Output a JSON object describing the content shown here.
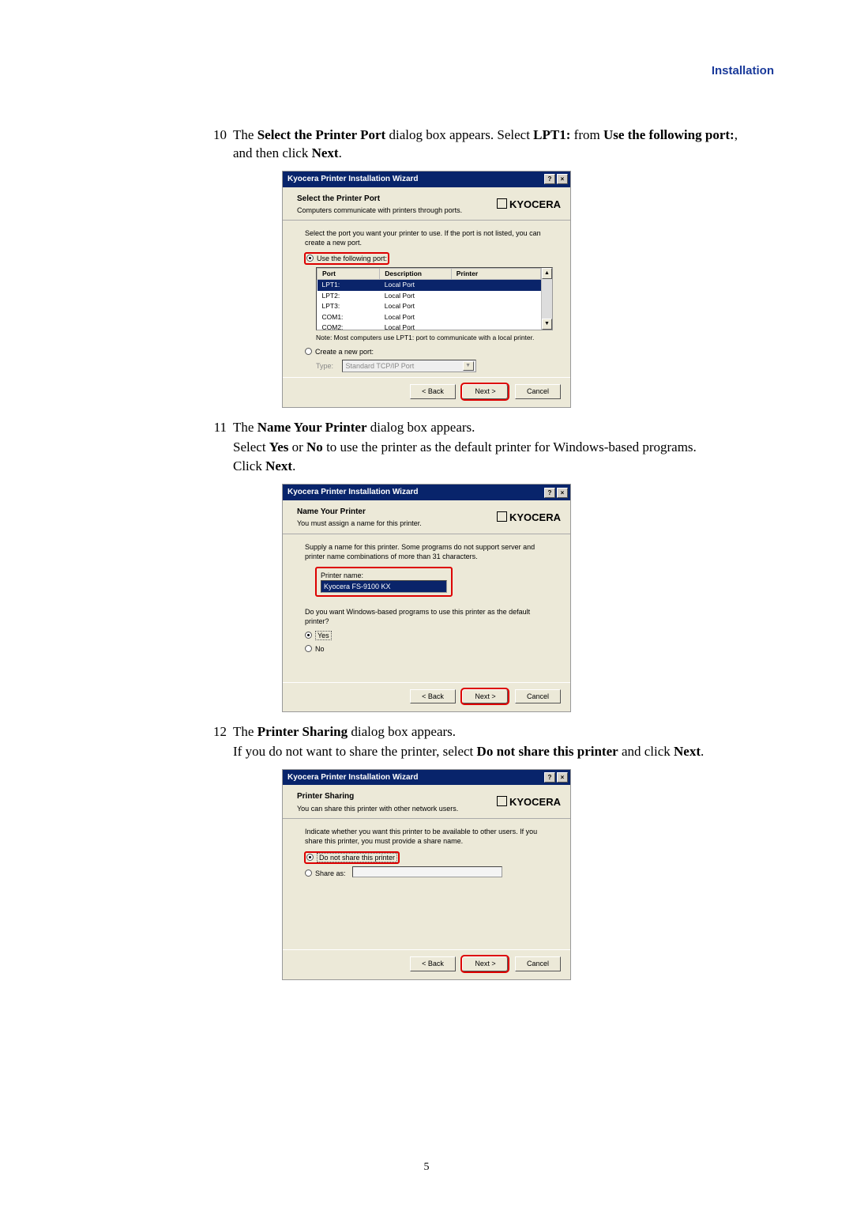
{
  "header_right": "Installation",
  "page_number": "5",
  "steps": {
    "s10": {
      "num": "10",
      "text_pre": "The ",
      "b1": "Select the Printer Port",
      "text_mid1": " dialog box appears. Select ",
      "b2": "LPT1:",
      "text_mid2": " from ",
      "b3": "Use the following port:",
      "text_mid3": ", and then click ",
      "b4": "Next",
      "text_end": "."
    },
    "s11": {
      "num": "11",
      "line1_pre": "The ",
      "line1_b": "Name Your Printer",
      "line1_post": " dialog box appears.",
      "line2_pre": "Select ",
      "line2_b1": "Yes",
      "line2_mid": " or ",
      "line2_b2": "No",
      "line2_post": " to use the printer as the default printer for Windows-based programs.",
      "line3_pre": "Click ",
      "line3_b": "Next",
      "line3_post": "."
    },
    "s12": {
      "num": "12",
      "line1_pre": "The ",
      "line1_b": "Printer Sharing",
      "line1_post": " dialog box appears.",
      "line2_pre": "If you do not want to share the printer, select ",
      "line2_b1": "Do not share this printer",
      "line2_mid": " and click ",
      "line2_b2": "Next",
      "line2_post": "."
    }
  },
  "dlg1": {
    "titlebar": "Kyocera Printer Installation Wizard",
    "help": "?",
    "close": "×",
    "brand": "KYOCERA",
    "htitle": "Select the Printer Port",
    "hsub": "Computers communicate with printers through ports.",
    "intro": "Select the port you want your printer to use. If the port is not listed, you can create a new port.",
    "radio1": "Use the following port:",
    "cols": {
      "c1": "Port",
      "c2": "Description",
      "c3": "Printer"
    },
    "rows": [
      {
        "c1": "LPT1:",
        "c2": "Local Port",
        "c3": ""
      },
      {
        "c1": "LPT2:",
        "c2": "Local Port",
        "c3": ""
      },
      {
        "c1": "LPT3:",
        "c2": "Local Port",
        "c3": ""
      },
      {
        "c1": "COM1:",
        "c2": "Local Port",
        "c3": ""
      },
      {
        "c1": "COM2:",
        "c2": "Local Port",
        "c3": ""
      }
    ],
    "note": "Note: Most computers use LPT1: port to communicate with a local printer.",
    "radio2": "Create a new port:",
    "typelabel": "Type:",
    "typedrop": "Standard TCP/IP Port",
    "back": "< Back",
    "next": "Next >",
    "cancel": "Cancel"
  },
  "dlg2": {
    "titlebar": "Kyocera Printer Installation Wizard",
    "help": "?",
    "close": "×",
    "brand": "KYOCERA",
    "htitle": "Name Your Printer",
    "hsub": "You must assign a name for this printer.",
    "intro": "Supply a name for this printer. Some programs do not support server and printer name combinations of more than 31 characters.",
    "pname_label": "Printer name:",
    "pname_value": "Kyocera FS-9100 KX",
    "defq": "Do you want Windows-based programs to use this printer as the default printer?",
    "yes": "Yes",
    "no": "No",
    "back": "< Back",
    "next": "Next >",
    "cancel": "Cancel"
  },
  "dlg3": {
    "titlebar": "Kyocera Printer Installation Wizard",
    "help": "?",
    "close": "×",
    "brand": "KYOCERA",
    "htitle": "Printer Sharing",
    "hsub": "You can share this printer with other network users.",
    "intro": "Indicate whether you want this printer to be available to other users. If you share this printer, you must provide a share name.",
    "radio1": "Do not share this printer",
    "radio2": "Share as:",
    "back": "< Back",
    "next": "Next >",
    "cancel": "Cancel"
  }
}
